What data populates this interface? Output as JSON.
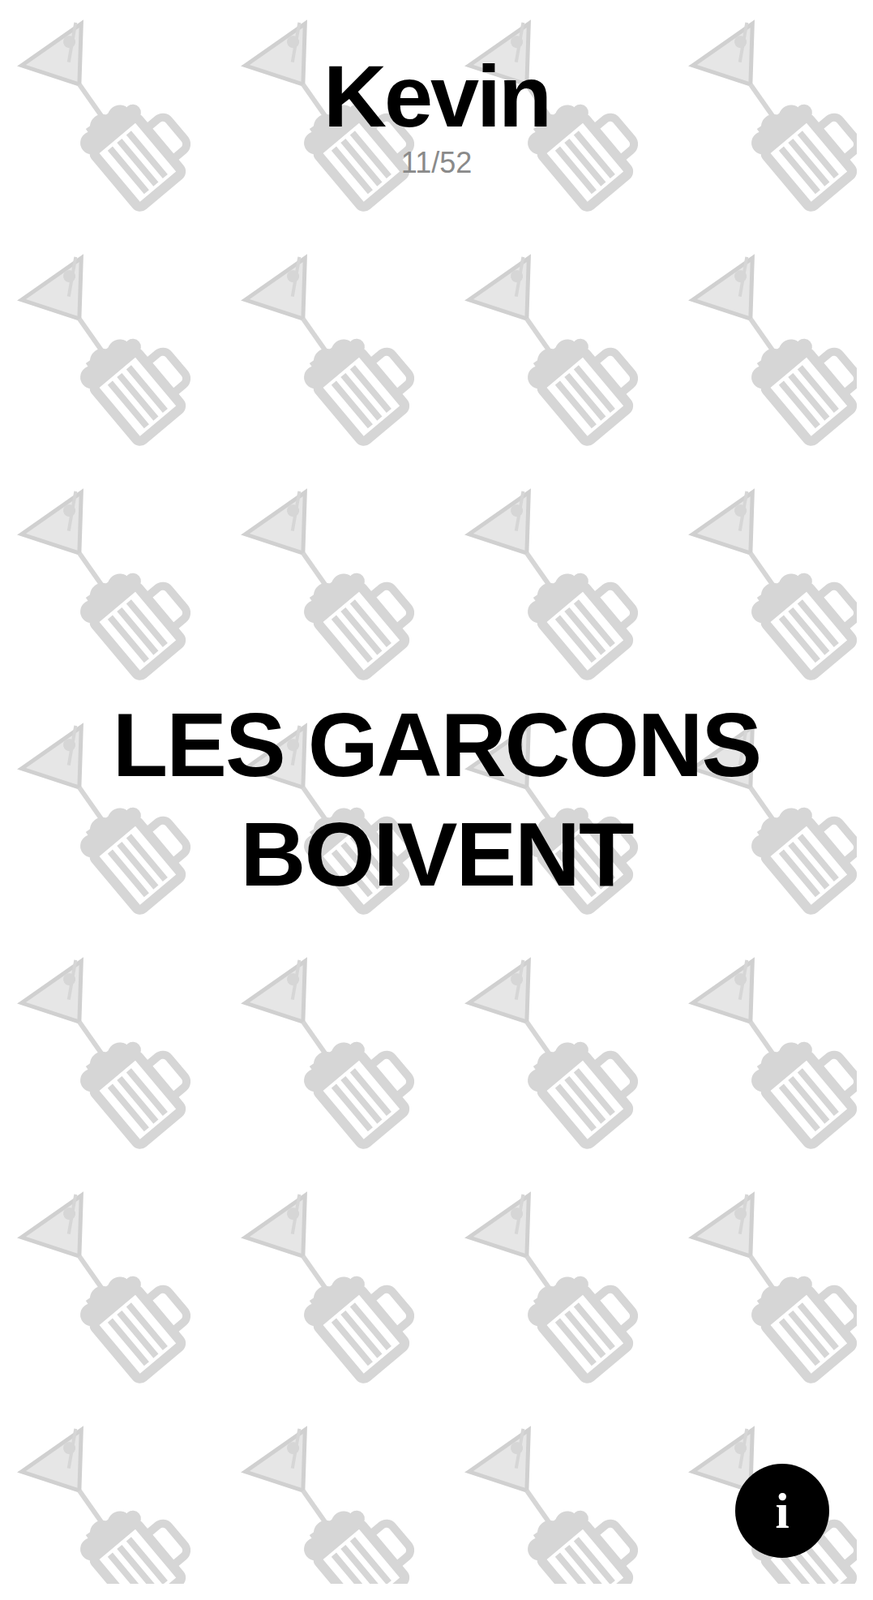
{
  "player": {
    "name": "Kevin"
  },
  "counter": "11/52",
  "card": {
    "text": "LES GARCONS BOIVENT"
  },
  "info_button": {
    "label": "i"
  }
}
